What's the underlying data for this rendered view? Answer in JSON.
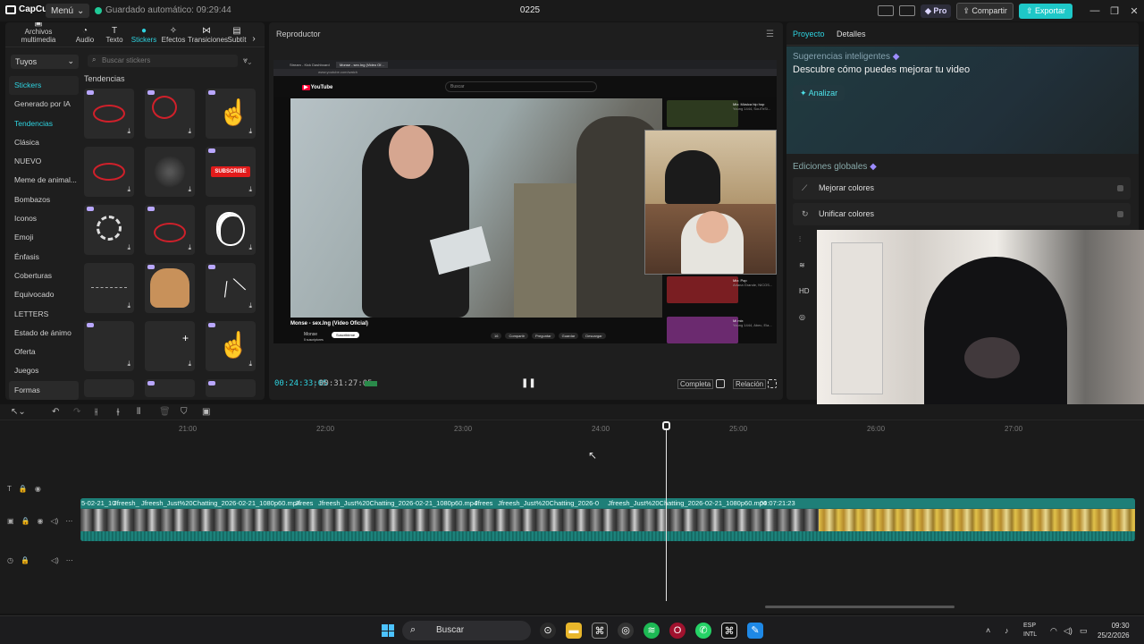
{
  "app": {
    "logo_text": "CapCut",
    "menu_label": "Menú",
    "autosave": "Guardado automático: 09:29:44",
    "project_title": "0225",
    "pro_label": "Pro",
    "share_label": "Compartir",
    "export_label": "Exportar",
    "colors": {
      "accent": "#2ed3e0",
      "export": "#1ec8c8",
      "bg": "#141414"
    }
  },
  "left_panel": {
    "tabs": [
      {
        "label": "Archivos multimedia",
        "icon": "media-icon"
      },
      {
        "label": "Audio",
        "icon": "audio-icon"
      },
      {
        "label": "Texto",
        "icon": "text-icon"
      },
      {
        "label": "Stickers",
        "icon": "sticker-icon",
        "active": true
      },
      {
        "label": "Efectos",
        "icon": "effects-icon"
      },
      {
        "label": "Transiciones",
        "icon": "transitions-icon"
      },
      {
        "label": "Subtít",
        "icon": "subtitles-icon"
      }
    ],
    "dropdown": "Tuyos",
    "section": "Stickers",
    "categories": [
      "Generado por IA",
      "Tendencias",
      "Clásica",
      "NUEVO",
      "Meme de animal...",
      "Bombazos",
      "Iconos",
      "Emoji",
      "Énfasis",
      "Coberturas",
      "Equivocado",
      "LETTERS",
      "Estado de ánimo",
      "Oferta",
      "Juegos",
      "Formas"
    ],
    "active_category": "Tendencias",
    "search_placeholder": "Buscar stickers",
    "grid_title": "Tendencias",
    "subscribe_text": "SUBSCRIBE"
  },
  "player": {
    "title": "Reproductor",
    "current_time": "00:24:33:05",
    "total_time": "00:31:27:05",
    "full_label": "Completa",
    "ratio_label": "Relación",
    "browser": {
      "tab1": "Stream - Kick Dashboard",
      "tab2": "Monse - sex.Ing (Video Of...",
      "url": "www.youtube.com/watch",
      "yt_logo": "YouTube",
      "search": "Buscar",
      "video_title": "Monse - sex.Ing (Video Oficial)",
      "channel": "Monse",
      "subscribers": "5 suscriptores",
      "subscribe": "Suscribirme",
      "actions": [
        "16",
        "Compartir",
        "Preguntar",
        "Guardar",
        "Descargar"
      ],
      "recs": [
        {
          "title": "Mix: Música hip hop",
          "sub": "Young 1444, SouThSi..."
        },
        {
          "title": "Mix: Pop",
          "sub": "Ariana Grande, NICOS..."
        },
        {
          "title": "Mi mix",
          "sub": "Young 1444, Abec, Ela..."
        }
      ]
    }
  },
  "right_panel": {
    "tabs": [
      "Proyecto",
      "Detalles"
    ],
    "smart_title": "Sugerencias inteligentes",
    "smart_sub": "Descubre cómo puedes mejorar tu video",
    "analyze": "Analizar",
    "global_title": "Ediciones globales",
    "global_items": [
      "Mejorar colores",
      "Unificar colores"
    ],
    "hd_label": "HD"
  },
  "timeline": {
    "ruler": [
      "21:00",
      "22:00",
      "23:00",
      "24:00",
      "25:00",
      "26:00",
      "27:00"
    ],
    "clip_labels": [
      "5-02-21_10",
      "Jfreesh_",
      "Jfreesh_Just%20Chatting_2026-02-21_1080p60.mp4",
      "Jfrees",
      "Jfreesh_Just%20Chatting_2026-02-21_1080p60.mp4",
      "Jfrees",
      "Jfreesh_Just%20Chatting_2026-0",
      "Jfreesh_Just%20Chatting_2026-02-21_1080p60.mp4",
      "00:07:21:23"
    ]
  },
  "taskbar": {
    "search": "Buscar",
    "lang1": "ESP",
    "lang2": "INTL",
    "time": "09:30",
    "date": "25/2/2026"
  }
}
